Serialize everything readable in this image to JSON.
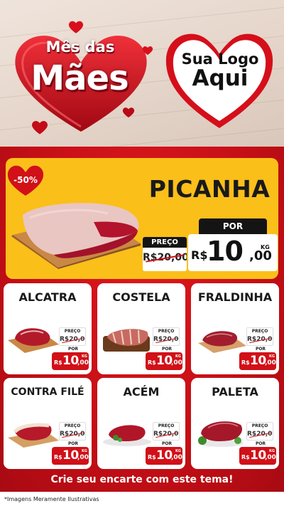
{
  "header": {
    "title_small": "Mês das",
    "title_big": "Mães",
    "logo_line1": "Sua Logo",
    "logo_line2": "Aqui"
  },
  "hero": {
    "discount": "-50%",
    "name": "PICANHA",
    "por_label": "POR",
    "preco_label": "PREÇO",
    "old_price": "R$20,00",
    "currency": "R$",
    "price_int": "10",
    "price_dec": ",00",
    "unit": "KG"
  },
  "products": [
    {
      "name": "ALCATRA",
      "preco_label": "PREÇO",
      "old_price": "R$20,00",
      "por_label": "POR",
      "currency": "R$",
      "price_int": "10",
      "price_dec": ",00",
      "unit": "KG"
    },
    {
      "name": "COSTELA",
      "preco_label": "PREÇO",
      "old_price": "R$20,00",
      "por_label": "POR",
      "currency": "R$",
      "price_int": "10",
      "price_dec": ",00",
      "unit": "KG"
    },
    {
      "name": "FRALDINHA",
      "preco_label": "PREÇO",
      "old_price": "R$20,00",
      "por_label": "POR",
      "currency": "R$",
      "price_int": "10",
      "price_dec": ",00",
      "unit": "KG"
    },
    {
      "name": "CONTRA FILÉ",
      "preco_label": "PREÇO",
      "old_price": "R$20,00",
      "por_label": "POR",
      "currency": "R$",
      "price_int": "10",
      "price_dec": ",00",
      "unit": "KG"
    },
    {
      "name": "ACÉM",
      "preco_label": "PREÇO",
      "old_price": "R$20,00",
      "por_label": "POR",
      "currency": "R$",
      "price_int": "10",
      "price_dec": ",00",
      "unit": "KG"
    },
    {
      "name": "PALETA",
      "preco_label": "PREÇO",
      "old_price": "R$20,00",
      "por_label": "POR",
      "currency": "R$",
      "price_int": "10",
      "price_dec": ",00",
      "unit": "KG"
    }
  ],
  "footer": {
    "cta": "Crie seu encarte com este tema!",
    "disclaimer": "*Imagens Meramente Ilustrativas"
  },
  "colors": {
    "brand_red": "#c40e16",
    "hero_yellow": "#fbbf1a",
    "price_red": "#d11018"
  },
  "icons": [
    "heart-icon"
  ]
}
